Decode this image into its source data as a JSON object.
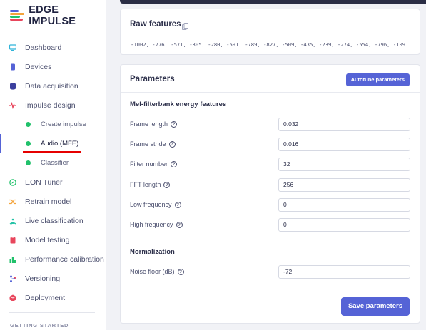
{
  "app": {
    "brand": "EDGE IMPULSE"
  },
  "sidebar": {
    "items": [
      {
        "label": "Dashboard",
        "icon": "monitor-icon"
      },
      {
        "label": "Devices",
        "icon": "chip-icon"
      },
      {
        "label": "Data acquisition",
        "icon": "database-icon"
      },
      {
        "label": "Impulse design",
        "icon": "pulse-icon"
      }
    ],
    "sub_items": [
      {
        "label": "Create impulse"
      },
      {
        "label": "Audio (MFE)"
      },
      {
        "label": "Classifier"
      }
    ],
    "items_after": [
      {
        "label": "EON Tuner",
        "icon": "compass-icon"
      },
      {
        "label": "Retrain model",
        "icon": "shuffle-icon"
      },
      {
        "label": "Live classification",
        "icon": "antenna-icon"
      },
      {
        "label": "Model testing",
        "icon": "clipboard-icon"
      },
      {
        "label": "Performance calibration",
        "icon": "bar-chart-icon"
      },
      {
        "label": "Versioning",
        "icon": "branch-icon"
      },
      {
        "label": "Deployment",
        "icon": "box-icon"
      }
    ],
    "section_label": "GETTING STARTED"
  },
  "raw": {
    "title": "Raw features",
    "values": "-1002, -776, -571, -305, -280, -591, -789, -827, -509, -435, -239, -274, -554, -796, -109..."
  },
  "params": {
    "title": "Parameters",
    "autotune_label": "Autotune parameters",
    "mel_title": "Mel-filterbank energy features",
    "frame_length_label": "Frame length",
    "frame_length_value": "0.032",
    "frame_stride_label": "Frame stride",
    "frame_stride_value": "0.016",
    "filter_number_label": "Filter number",
    "filter_number_value": "32",
    "fft_length_label": "FFT length",
    "fft_length_value": "256",
    "low_freq_label": "Low frequency",
    "low_freq_value": "0",
    "high_freq_label": "High frequency",
    "high_freq_value": "0",
    "normalization_title": "Normalization",
    "noise_floor_label": "Noise floor (dB)",
    "noise_floor_value": "-72",
    "help_glyph": "?",
    "save_label": "Save parameters"
  },
  "colors": {
    "accent": "#5563d6",
    "active_dot": "#21c16b",
    "highlight": "#e60000"
  }
}
